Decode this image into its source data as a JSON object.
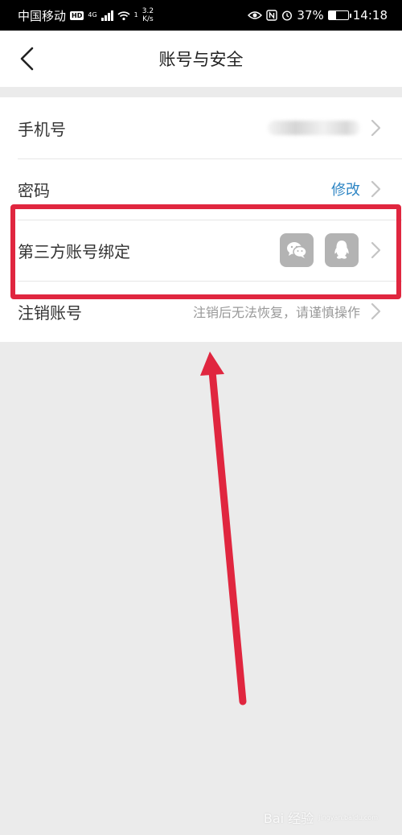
{
  "status_bar": {
    "carrier": "中国移动",
    "hd_badge": "HD",
    "network_gen": "4G",
    "wifi_sup": "1",
    "speed_value": "3.2",
    "speed_unit": "K/s",
    "battery": "37%",
    "time": "14:18"
  },
  "nav": {
    "title": "账号与安全"
  },
  "settings": {
    "phone": {
      "label": "手机号"
    },
    "password": {
      "label": "密码",
      "action": "修改"
    },
    "third_party": {
      "label": "第三方账号绑定"
    },
    "cancel_account": {
      "label": "注销账号",
      "hint": "注销后无法恢复，请谨慎操作"
    }
  },
  "colors": {
    "link": "#2f86c4",
    "highlight": "#e0263f",
    "page_bg": "#ebebeb"
  },
  "watermark": {
    "brand": "Bai 经验",
    "url": "jingyan.baidu.com"
  }
}
